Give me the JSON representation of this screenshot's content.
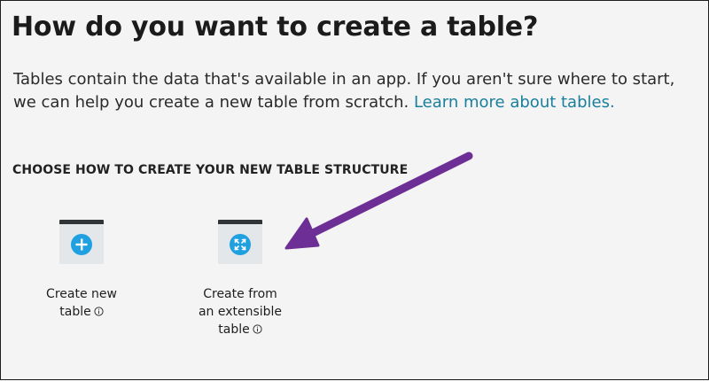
{
  "header": {
    "title": "How do you want to create a table?"
  },
  "description": {
    "text": "Tables contain the data that's available in an app. If you aren't sure where to start, we can help you create a new table from scratch. ",
    "link_text": "Learn more about tables."
  },
  "section": {
    "label": "CHOOSE HOW TO CREATE YOUR NEW TABLE STRUCTURE"
  },
  "options": [
    {
      "line1": "Create new",
      "line2": "table",
      "icon": "plus-icon"
    },
    {
      "line1": "Create from",
      "line2": "an extensible",
      "line3": "table",
      "icon": "expand-icon"
    }
  ],
  "colors": {
    "link": "#1a7f9c",
    "icon_blue": "#1ea0e1",
    "tile_background": "#e3e7ea",
    "tile_top_bar": "#2f3537",
    "arrow": "#6d2f96"
  }
}
